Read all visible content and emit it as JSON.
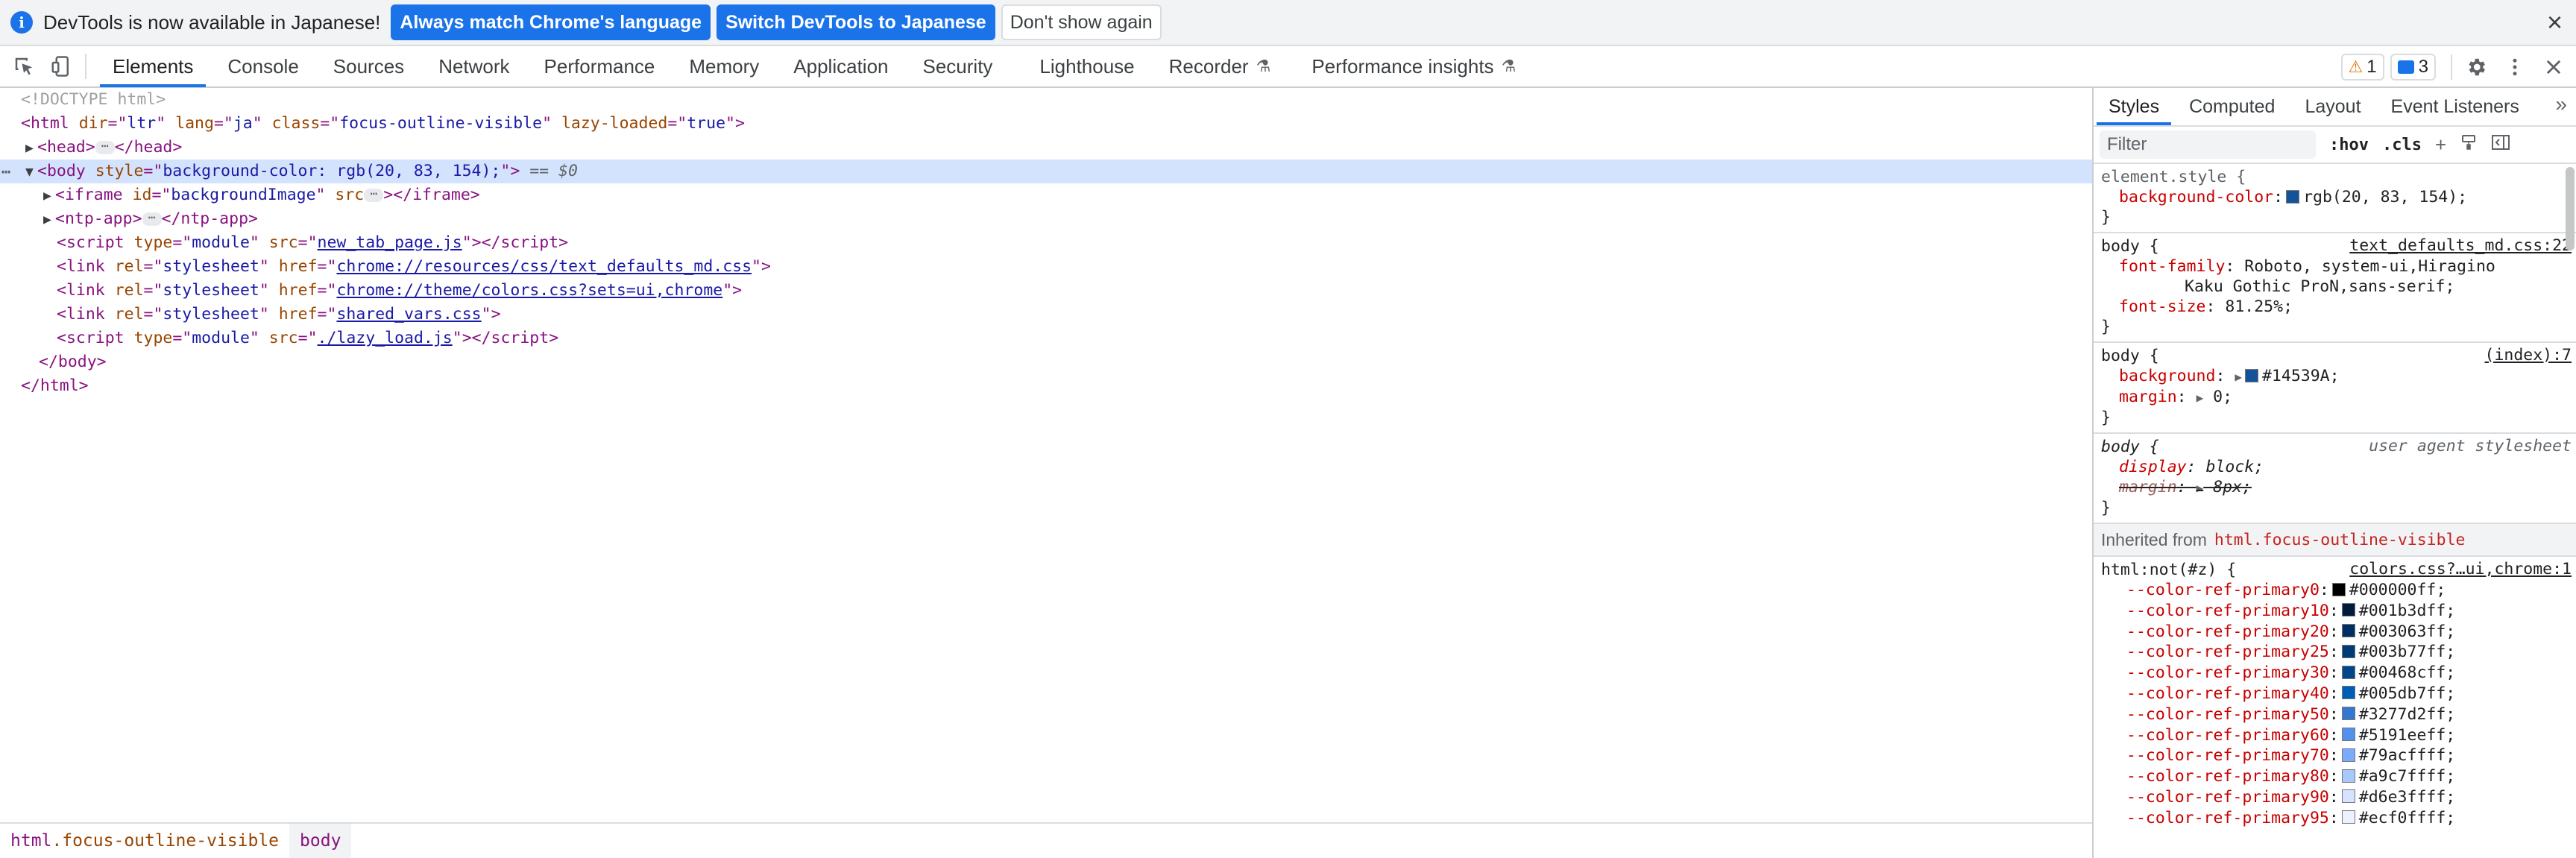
{
  "infobar": {
    "icon": "info-icon",
    "message": "DevTools is now available in Japanese!",
    "buttons": [
      {
        "label": "Always match Chrome's language",
        "style": "primary"
      },
      {
        "label": "Switch DevTools to Japanese",
        "style": "primary"
      },
      {
        "label": "Don't show again",
        "style": "secondary"
      }
    ],
    "close": "×"
  },
  "toolbar": {
    "tabs": [
      {
        "label": "Elements",
        "active": true
      },
      {
        "label": "Console"
      },
      {
        "label": "Sources"
      },
      {
        "label": "Network"
      },
      {
        "label": "Performance"
      },
      {
        "label": "Memory"
      },
      {
        "label": "Application"
      },
      {
        "label": "Security"
      },
      {
        "label": "Lighthouse"
      },
      {
        "label": "Recorder",
        "experimental": true
      },
      {
        "label": "Performance insights",
        "experimental": true
      }
    ],
    "warnings_count": "1",
    "messages_count": "3",
    "colors": {
      "accent": "#1a73e8",
      "warning": "#e37400"
    }
  },
  "elements": {
    "doctype": "<!DOCTYPE html>",
    "html_tag": {
      "attrs": [
        [
          "dir",
          "ltr"
        ],
        [
          "lang",
          "ja"
        ],
        [
          "class",
          "focus-outline-visible"
        ],
        [
          "lazy-loaded",
          "true"
        ]
      ]
    },
    "head": "head",
    "body_style": "background-color: rgb(20, 83, 154);",
    "selected_marker": "== $0",
    "children": [
      {
        "kind": "collapsed",
        "tag": "iframe",
        "attrs": [
          [
            "id",
            "backgroundImage"
          ]
        ],
        "bare_attr": "src"
      },
      {
        "kind": "collapsed",
        "tag": "ntp-app"
      },
      {
        "kind": "script",
        "attrs": [
          [
            "type",
            "module"
          ]
        ],
        "link_attr": "src",
        "link": "new_tab_page.js"
      },
      {
        "kind": "link",
        "attrs": [
          [
            "rel",
            "stylesheet"
          ]
        ],
        "link_attr": "href",
        "link": "chrome://resources/css/text_defaults_md.css"
      },
      {
        "kind": "link",
        "attrs": [
          [
            "rel",
            "stylesheet"
          ]
        ],
        "link_attr": "href",
        "link": "chrome://theme/colors.css?sets=ui,chrome"
      },
      {
        "kind": "link",
        "attrs": [
          [
            "rel",
            "stylesheet"
          ]
        ],
        "link_attr": "href",
        "link": "shared_vars.css"
      },
      {
        "kind": "script",
        "attrs": [
          [
            "type",
            "module"
          ]
        ],
        "link_attr": "src",
        "link": "./lazy_load.js"
      }
    ],
    "close_body": "</body>",
    "close_html": "</html>"
  },
  "breadcrumb": [
    {
      "tag": "html",
      "cls": ".focus-outline-visible"
    },
    {
      "tag": "body",
      "cls": ""
    }
  ],
  "styles": {
    "tabs": [
      "Styles",
      "Computed",
      "Layout",
      "Event Listeners"
    ],
    "more": "»",
    "filter_placeholder": "Filter",
    "hov": ":hov",
    "cls": ".cls",
    "rules": [
      {
        "selector": "element.style {",
        "source": "",
        "props": [
          {
            "name": "background-color",
            "value": "rgb(20, 83, 154)",
            "swatch": "#14539a"
          }
        ]
      },
      {
        "selector": "body {",
        "source": "text_defaults_md.css:22",
        "props": [
          {
            "name": "font-family",
            "value": "Roboto, system-ui,Hiragino",
            "cont": "Kaku Gothic ProN,sans-serif"
          },
          {
            "name": "font-size",
            "value": "81.25%"
          }
        ]
      },
      {
        "selector": "body {",
        "source": "(index):7",
        "props": [
          {
            "name": "background",
            "value": "#14539A",
            "swatch": "#14539a",
            "expander": true
          },
          {
            "name": "margin",
            "value": "0",
            "expander": true
          }
        ]
      },
      {
        "selector": "body {",
        "source": "user agent stylesheet",
        "ua": true,
        "props": [
          {
            "name": "display",
            "value": "block"
          },
          {
            "name": "margin",
            "value": "8px",
            "struck": true,
            "expander": true
          }
        ]
      }
    ],
    "inherited_label": "Inherited from",
    "inherited_selector": "html.focus-outline-visible",
    "inherited_rule": {
      "selector": "html:not(#z) {",
      "source": "colors.css?…ui,chrome:1"
    },
    "vars": [
      {
        "name": "--color-ref-primary0",
        "value": "#000000ff",
        "swatch": "#000000"
      },
      {
        "name": "--color-ref-primary10",
        "value": "#001b3dff",
        "swatch": "#001b3d"
      },
      {
        "name": "--color-ref-primary20",
        "value": "#003063ff",
        "swatch": "#003063"
      },
      {
        "name": "--color-ref-primary25",
        "value": "#003b77ff",
        "swatch": "#003b77"
      },
      {
        "name": "--color-ref-primary30",
        "value": "#00468cff",
        "swatch": "#00468c"
      },
      {
        "name": "--color-ref-primary40",
        "value": "#005db7ff",
        "swatch": "#005db7"
      },
      {
        "name": "--color-ref-primary50",
        "value": "#3277d2ff",
        "swatch": "#3277d2"
      },
      {
        "name": "--color-ref-primary60",
        "value": "#5191eeff",
        "swatch": "#5191ee"
      },
      {
        "name": "--color-ref-primary70",
        "value": "#79acffff",
        "swatch": "#79acff"
      },
      {
        "name": "--color-ref-primary80",
        "value": "#a9c7ffff",
        "swatch": "#a9c7ff"
      },
      {
        "name": "--color-ref-primary90",
        "value": "#d6e3ffff",
        "swatch": "#d6e3ff"
      },
      {
        "name": "--color-ref-primary95",
        "value": "#ecf0ffff",
        "swatch": "#ecf0ff"
      }
    ]
  }
}
